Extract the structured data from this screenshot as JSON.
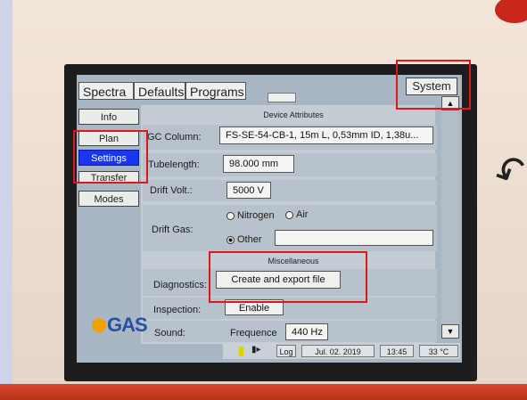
{
  "tabs": [
    {
      "label": "Spectra"
    },
    {
      "label": "Defaults"
    },
    {
      "label": "Programs"
    }
  ],
  "system_tab": "System",
  "side_menu": [
    {
      "label": "Info"
    },
    {
      "label": "Plan"
    },
    {
      "label": "Settings",
      "active": true
    },
    {
      "label": "Transfer"
    },
    {
      "label": "Modes"
    }
  ],
  "device_attributes": {
    "header": "Device Attributes",
    "gc_column_label": "GC Column:",
    "gc_column_value": "FS-SE-54-CB-1, 15m L, 0,53mm ID, 1,38u...",
    "tubelength_label": "Tubelength:",
    "tubelength_value": "98.000 mm",
    "drift_volt_label": "Drift Volt.:",
    "drift_volt_value": "5000 V",
    "drift_gas_label": "Drift Gas:",
    "drift_gas_options": [
      "Nitrogen",
      "Air",
      "Other"
    ],
    "drift_gas_selected": "Other",
    "other_value": ""
  },
  "miscellaneous": {
    "header": "Miscellaneous",
    "diagnostics_label": "Diagnostics:",
    "diagnostics_button": "Create and export file",
    "inspection_label": "Inspection:",
    "inspection_button": "Enable",
    "sound_label": "Sound:",
    "frequence_label": "Frequence",
    "frequence_value": "440 Hz"
  },
  "logo": "GAS",
  "status": {
    "log": "Log",
    "date": "Jul. 02. 2019",
    "time": "13:45",
    "temp": "33 °C"
  },
  "colors": {
    "active_menu": "#1a36f0",
    "annotation": "#e21616",
    "logo_blue": "#2b4fa8",
    "logo_orange": "#f0a300"
  }
}
